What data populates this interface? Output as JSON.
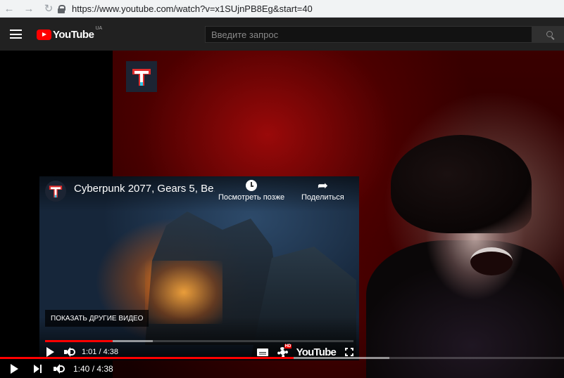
{
  "browser": {
    "url": "https://www.youtube.com/watch?v=x1SUjnPB8Eg&start=40"
  },
  "header": {
    "logo_text": "YouTube",
    "region": "UA",
    "search_placeholder": "Введите запрос"
  },
  "embed": {
    "title": "Cyberpunk 2077, Gears 5, Be...",
    "watch_later": "Посмотреть позже",
    "share": "Поделиться",
    "more_videos": "ПОКАЗАТЬ ДРУГИЕ ВИДЕО",
    "time": "1:01 / 4:38",
    "progress_played": 0.22,
    "progress_buffered": 0.35,
    "logo_text": "YouTube",
    "hd_badge": "HD"
  },
  "player": {
    "time": "1:40 / 4:38",
    "progress_played": 0.52,
    "progress_buffered": 0.69
  },
  "colors": {
    "accent": "#ff0000",
    "header_bg": "#212121",
    "search_bg": "#121212"
  },
  "icons": {
    "back": "arrow-left-icon",
    "forward": "arrow-right-icon",
    "reload": "reload-icon",
    "lock": "lock-icon",
    "menu": "hamburger-icon",
    "search": "search-icon",
    "play": "play-icon",
    "next": "next-icon",
    "volume": "volume-icon",
    "subtitles": "subtitles-icon",
    "settings": "gear-icon",
    "fullscreen": "fullscreen-icon",
    "clock": "clock-icon",
    "share": "share-icon"
  }
}
